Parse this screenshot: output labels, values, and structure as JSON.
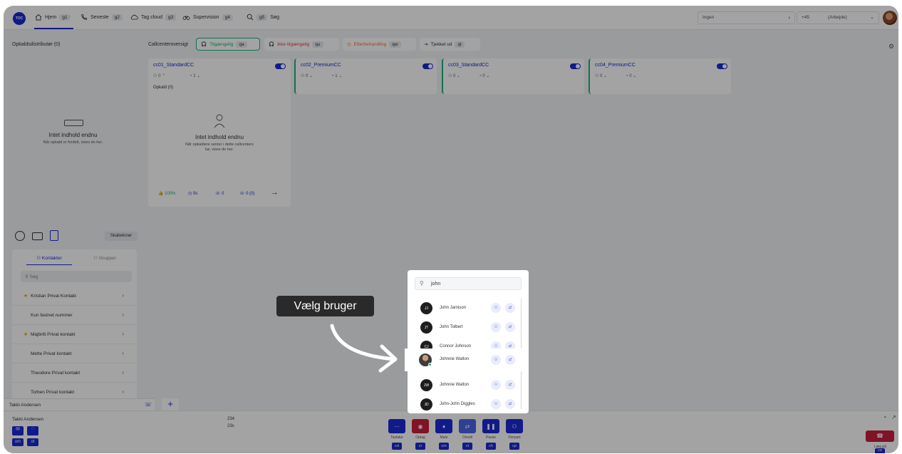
{
  "topbar": {
    "logo": "TOC",
    "nav": [
      {
        "label": "Hjem",
        "key": "g1",
        "icon": "home-icon"
      },
      {
        "label": "Seneste",
        "key": "g2",
        "icon": "phone-icon"
      },
      {
        "label": "Tag cloud",
        "key": "g3",
        "icon": "cloud-icon"
      },
      {
        "label": "Supervision",
        "key": "g4",
        "icon": "binoculars-icon"
      },
      {
        "label": "Søg",
        "key": "g5",
        "icon": "search-icon"
      }
    ],
    "status_value": "Ingen",
    "number_prefix": "+45",
    "number_label": "(Arbejde)"
  },
  "distributor": {
    "title": "Opkaldsdistributør (0)",
    "empty_title": "Intet indhold endnu",
    "empty_sub": "Når opkald er fordelt, vises de her."
  },
  "overview": {
    "label": "Callcenteroversigt",
    "chips": [
      {
        "label": "Tilgængelig",
        "key": "qa"
      },
      {
        "label": "Ikke tilgængelig",
        "key": "qu"
      },
      {
        "label": "Efterbehandling",
        "key": "qw"
      },
      {
        "label": "Tjekket ud",
        "key": "ql"
      }
    ]
  },
  "callcenters": [
    {
      "name": "cc01_StandardCC",
      "agents": "0",
      "queue": "1"
    },
    {
      "name": "cc02_PremiumCC",
      "agents": "0",
      "queue": "1"
    },
    {
      "name": "cc03_StandardCC",
      "agents": "0",
      "queue": "0"
    },
    {
      "name": "cc04_PremiumCC",
      "agents": "0",
      "queue": "0"
    }
  ],
  "cc01_detail": {
    "calls_label": "Opkald (0)",
    "empty_title": "Intet indhold endnu",
    "empty_sub": "Når opkaldere venter i dette callcenters kø, vises de her.",
    "stats": [
      "100%",
      "0s",
      "0",
      "0 (0)"
    ]
  },
  "messaging": {
    "templates_button": "Skabeloner"
  },
  "contacts": {
    "tab_contacts": "Kontakter",
    "tab_groups": "Grupper",
    "search_placeholder": "Søg",
    "items": [
      {
        "name": "Kristian Privat Kontakt",
        "star": true
      },
      {
        "name": "Kun fastnet nummer",
        "star": false
      },
      {
        "name": "Majbritt Privat kontakt",
        "star": true
      },
      {
        "name": "Mette Privat kontakt",
        "star": false
      },
      {
        "name": "Theodore Privat kontakt",
        "star": false
      },
      {
        "name": "Torben Privat kontakt",
        "star": false
      }
    ],
    "footer_user": "Takki Andersen"
  },
  "call": {
    "caller": "Takki Andersen",
    "number_a": "234",
    "number_b": "23s",
    "keys_left": [
      "om",
      "ot"
    ],
    "controls": [
      {
        "label": "Tastatur",
        "key": "cd"
      },
      {
        "label": "Optag",
        "key": "cr"
      },
      {
        "label": "Mute",
        "key": "cm"
      },
      {
        "label": "Omstil",
        "key": "ct"
      },
      {
        "label": "Pause",
        "key": "ch"
      },
      {
        "label": "Flerpart",
        "key": "cp"
      }
    ],
    "hangup_label": "Læg på",
    "hangup_key": "ce"
  },
  "popup": {
    "query": "john",
    "results": [
      {
        "initials": "JJ",
        "name": "John Jamison"
      },
      {
        "initials": "JT",
        "name": "John Tolbert"
      },
      {
        "initials": "CJ",
        "name": "Connor Johnson"
      },
      {
        "initials": "",
        "name": "Johnnie Walton"
      },
      {
        "initials": "JW",
        "name": "Johnnie Walton"
      },
      {
        "initials": "JD",
        "name": "John-John Diggles"
      }
    ]
  },
  "tooltip": {
    "text": "Vælg bruger"
  }
}
